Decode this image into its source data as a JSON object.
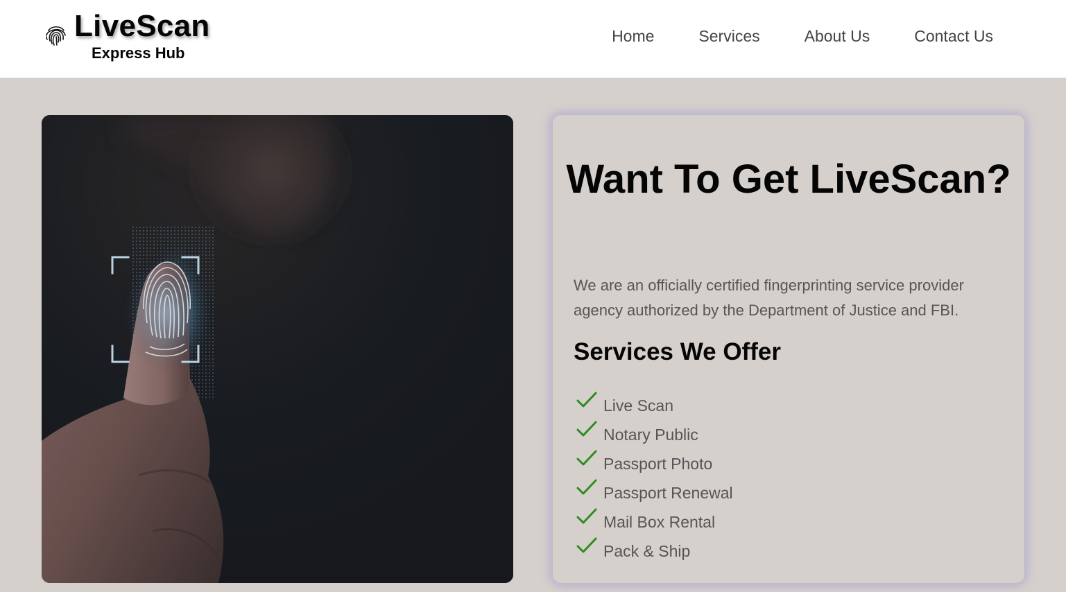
{
  "brand": {
    "title": "LiveScan",
    "subtitle": "Express Hub",
    "icon": "fingerprint-icon"
  },
  "nav": {
    "items": [
      {
        "label": "Home"
      },
      {
        "label": "Services"
      },
      {
        "label": "About Us"
      },
      {
        "label": "Contact Us"
      }
    ]
  },
  "hero": {
    "image": "thumb-fingerprint-scan-photo"
  },
  "card": {
    "title": "Want To Get LiveScan?",
    "description": "We are an officially certified fingerprinting service provider agency authorized by the Department of Justice and FBI.",
    "services_heading": "Services We Offer",
    "services": [
      {
        "label": "Live Scan"
      },
      {
        "label": "Notary Public"
      },
      {
        "label": "Passport Photo"
      },
      {
        "label": "Passport Renewal"
      },
      {
        "label": "Mail Box Rental"
      },
      {
        "label": "Pack & Ship"
      }
    ],
    "check_icon": "check-icon"
  },
  "colors": {
    "page_background": "#d6d0cd",
    "header_background": "#ffffff",
    "nav_text": "#444444",
    "check": "#2e8b1e",
    "card_glow": "#9696c8",
    "body_text": "#555555"
  }
}
